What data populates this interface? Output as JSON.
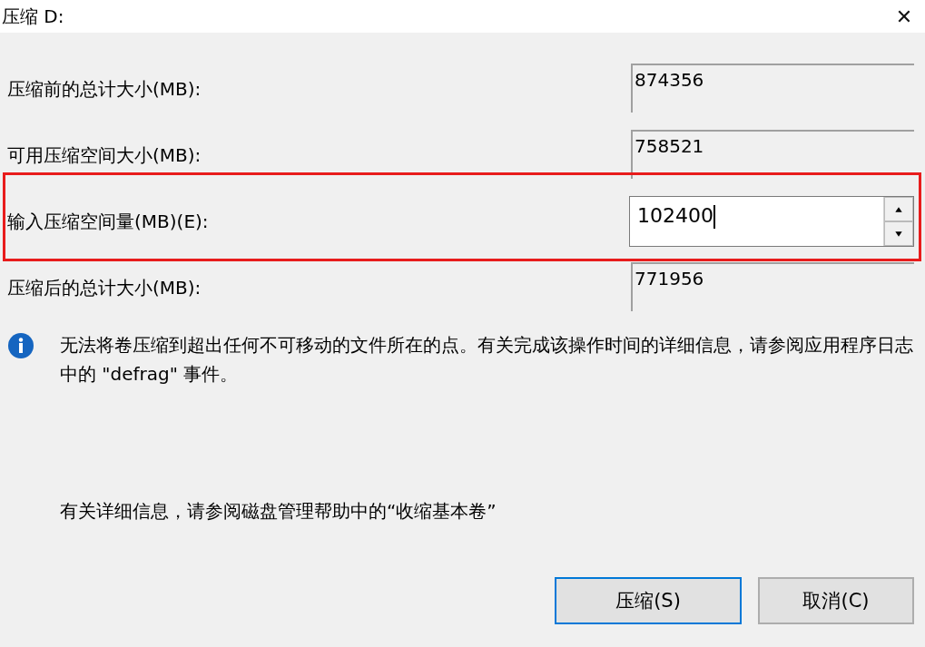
{
  "window": {
    "title": "压缩 D:",
    "close": "✕"
  },
  "fields": [
    {
      "label": "压缩前的总计大小(MB):",
      "value": "874356",
      "kind": "readonly",
      "highlighted": false
    },
    {
      "label": "可用压缩空间大小(MB):",
      "value": "758521",
      "kind": "readonly",
      "highlighted": false
    },
    {
      "label": "输入压缩空间量(MB)(E):",
      "value": "102400",
      "kind": "spin",
      "highlighted": true
    },
    {
      "label": "压缩后的总计大小(MB):",
      "value": "771956",
      "kind": "readonly",
      "highlighted": false
    }
  ],
  "info": {
    "message": "无法将卷压缩到超出任何不可移动的文件所在的点。有关完成该操作时间的详细信息，请参阅应用程序日志中的 \"defrag\" 事件。"
  },
  "help_text": "有关详细信息，请参阅磁盘管理帮助中的“收缩基本卷”",
  "buttons": [
    {
      "label": "压缩(S)",
      "default": true
    },
    {
      "label": "取消(C)",
      "default": false
    }
  ]
}
